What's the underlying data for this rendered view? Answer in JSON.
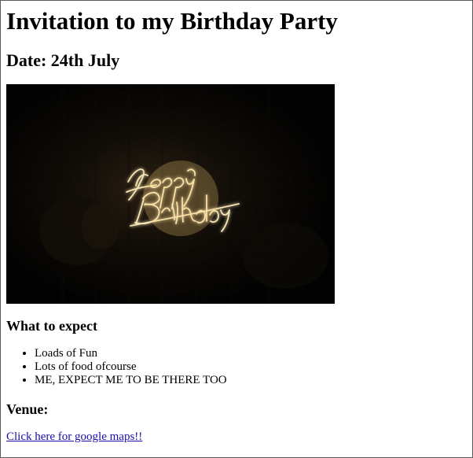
{
  "page": {
    "title": "Invitation to my Birthday Party",
    "date": "Date: 24th July"
  },
  "hero": {
    "image_name": "happy-birthday-neon-sign",
    "sign_line_1": "Happy",
    "sign_line_2": "Birthday",
    "colors": {
      "background": "#050403",
      "neon": "#f7e4b3",
      "glow": "#ffd27a"
    }
  },
  "expect": {
    "title": "What to expect",
    "items": [
      "Loads of Fun",
      "Lots of food ofcourse",
      "ME, EXPECT ME TO BE THERE TOO"
    ]
  },
  "venue": {
    "title": "Venue:",
    "link_text": "Click here for google maps!!"
  }
}
